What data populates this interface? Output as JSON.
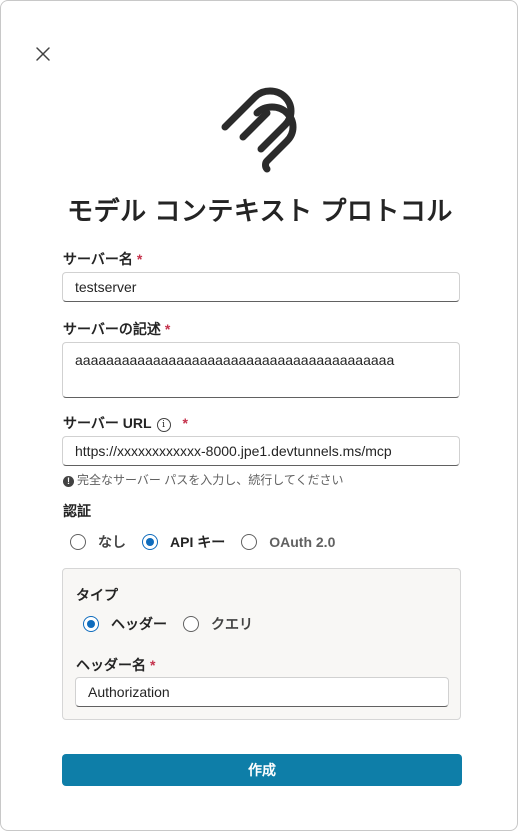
{
  "dialog": {
    "title": "モデル コンテキスト プロトコル"
  },
  "fields": {
    "server_name": {
      "label": "サーバー名",
      "required_mark": "*",
      "value": "testserver"
    },
    "server_description": {
      "label": "サーバーの記述",
      "required_mark": "*",
      "value": "aaaaaaaaaaaaaaaaaaaaaaaaaaaaaaaaaaaaaaaaa"
    },
    "server_url": {
      "label": "サーバー URL",
      "info_icon": "i",
      "required_mark": "*",
      "value": "https://xxxxxxxxxxxx-8000.jpe1.devtunnels.ms/mcp",
      "hint_icon": "!",
      "hint": "完全なサーバー パスを入力し、続行してください"
    }
  },
  "auth": {
    "label": "認証",
    "options": [
      {
        "label": "なし",
        "checked": false
      },
      {
        "label": "API キー",
        "checked": true
      },
      {
        "label": "OAuth 2.0",
        "checked": false
      }
    ],
    "type_label": "タイプ",
    "type_options": [
      {
        "label": "ヘッダー",
        "checked": true
      },
      {
        "label": "クエリ",
        "checked": false
      }
    ],
    "header_name": {
      "label": "ヘッダー名",
      "required_mark": "*",
      "value": "Authorization"
    }
  },
  "actions": {
    "create_label": "作成"
  },
  "icons": {
    "close": "close-icon",
    "logo": "mcp-logo-icon"
  },
  "colors": {
    "accent": "#0f6cbd",
    "primary_button": "#0e7ea8",
    "required": "#c4314b"
  }
}
